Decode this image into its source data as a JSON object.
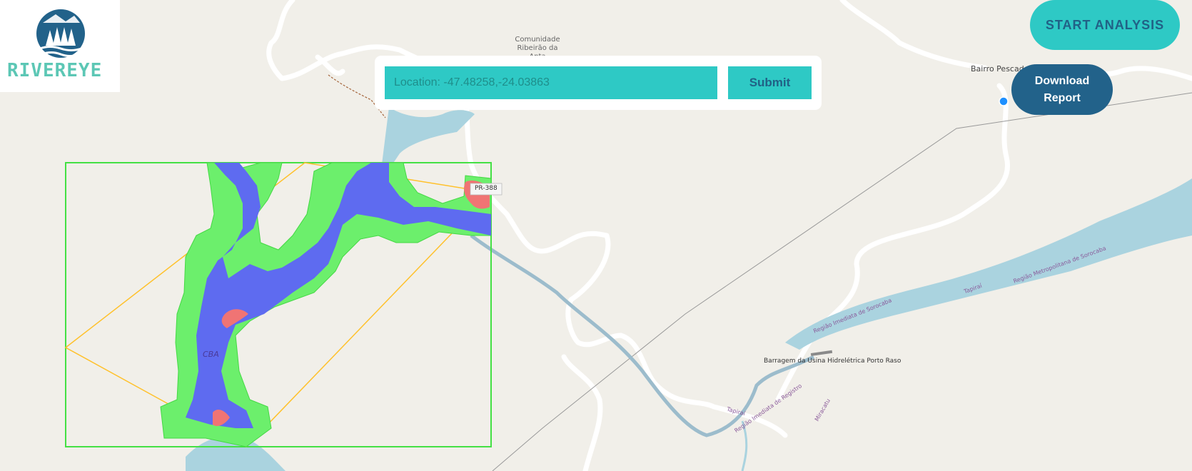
{
  "app": {
    "logo_text": "RIVEREYE"
  },
  "search": {
    "placeholder": "Location: -47.48258,-24.03863",
    "value": "",
    "submit_label": "Submit"
  },
  "actions": {
    "start_label": "START ANALYSIS",
    "download_label": "Download Report"
  },
  "map_labels": {
    "community": "Comunidade Ribeirão da Anta",
    "bairro": "Bairro Pescad",
    "barragem": "Barragem da Usina Hidrelétrica Porto Raso",
    "road": "PR-388",
    "reg_sorocaba": "Região Imediata de Sorocaba",
    "reg_metro_sorocaba": "Região Metropolitana de Sorocaba",
    "reg_registro": "Região Imediata de Registro",
    "tapirai_1": "Tapiraí",
    "tapirai_2": "Tapiraí",
    "miracatu": "Miracatu",
    "cba": "CBA"
  },
  "colors": {
    "accent": "#2ec9c5",
    "brand_dark": "#22628a",
    "logo_teal": "#5cc7b5",
    "water_detected": "#5e6bf0",
    "buffer_zone": "#6cef6c",
    "risk_zone": "#f07474",
    "bbox_outline": "#ffc12b",
    "river": "#aad3df"
  },
  "icons": {
    "logo": "forest-river-icon",
    "location_marker": "location-dot-icon"
  }
}
